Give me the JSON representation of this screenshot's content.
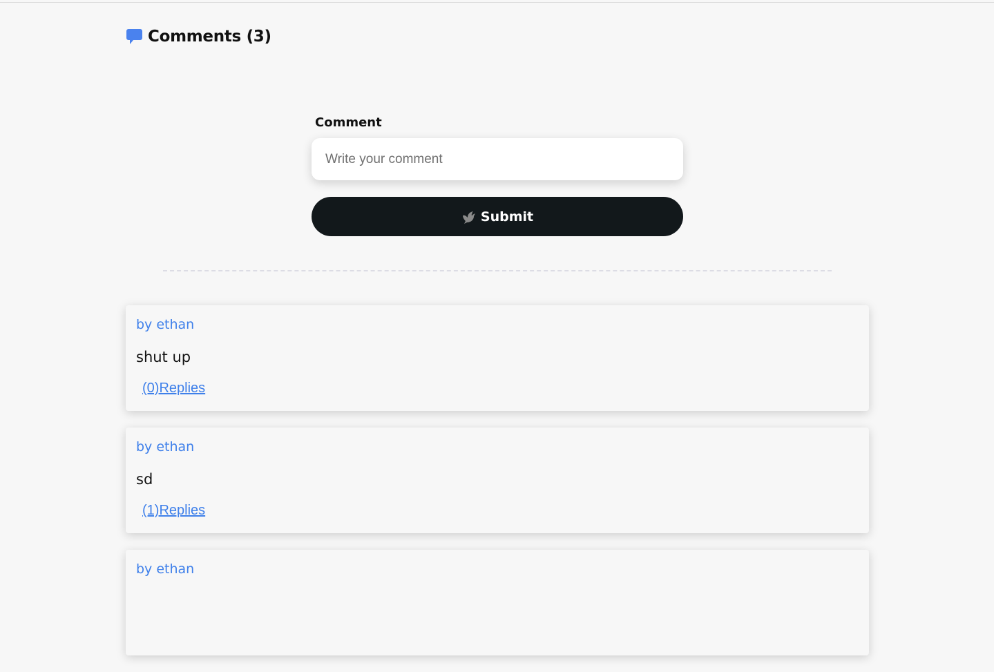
{
  "header": {
    "icon": "chat-bubble-icon",
    "title": "Comments (3)"
  },
  "form": {
    "label": "Comment",
    "input": {
      "placeholder": "Write your comment",
      "value": ""
    },
    "submit": {
      "icon": "dove-icon",
      "label": "Submit"
    }
  },
  "comments": [
    {
      "author": "by ethan",
      "text": "shut up",
      "replies": "(0)Replies"
    },
    {
      "author": "by ethan",
      "text": "sd",
      "replies": "(1)Replies"
    },
    {
      "author": "by ethan",
      "text": "",
      "replies": ""
    }
  ],
  "colors": {
    "accent": "#3f80ea",
    "button": "#12181b",
    "background": "#f7f7f7"
  }
}
